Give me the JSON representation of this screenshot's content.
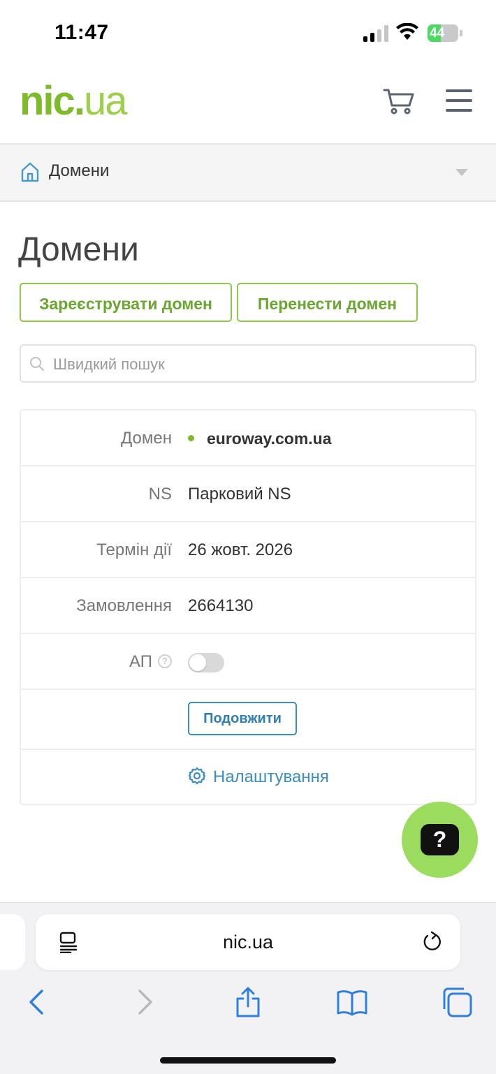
{
  "status_bar": {
    "time": "11:47",
    "battery": "44",
    "battery_level": 0.44
  },
  "header": {
    "logo": {
      "part1": "nic",
      "dot": ".",
      "part2": "ua"
    },
    "cart_icon": "cart-icon",
    "menu_icon": "hamburger-menu-icon"
  },
  "breadcrumb": {
    "label": "Домени",
    "home_icon": "home-icon"
  },
  "page": {
    "title": "Домени",
    "register_button": "Зареєструвати домен",
    "transfer_button": "Перенести домен",
    "search_placeholder": "Швидкий пошук"
  },
  "domain_card": {
    "domain_label": "Домен",
    "domain_value": "euroway.com.ua",
    "domain_status_color": "#7dbb2a",
    "ns_label": "NS",
    "ns_value": "Парковий NS",
    "expiry_label": "Термін дії",
    "expiry_value": "26 жовт. 2026",
    "order_label": "Замовлення",
    "order_value": "2664130",
    "autorenew_label": "АП",
    "autorenew_help": "?",
    "autorenew_enabled": false,
    "renew_button": "Подовжити",
    "settings_link": "Налаштування"
  },
  "help_fab": {
    "label": "?"
  },
  "browser": {
    "url": "nic.ua",
    "icons": [
      "reader-icon",
      "reload-icon",
      "back-icon",
      "forward-icon",
      "share-icon",
      "bookmarks-icon",
      "tabs-icon"
    ]
  },
  "colors": {
    "brand_green": "#7dbb2a",
    "link_blue": "#3a8fc0",
    "fab_green": "#9bdc5f"
  }
}
